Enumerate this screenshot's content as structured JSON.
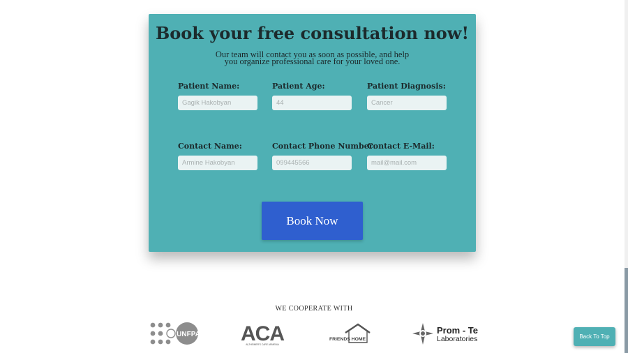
{
  "form": {
    "title": "Book your free consultation now!",
    "subtitle": "Our team will contact you as soon as possible, and help you organize professional care for your loved one.",
    "fields": [
      {
        "label": "Patient Name:",
        "placeholder": "Gagik Hakobyan"
      },
      {
        "label": "Patient Age:",
        "placeholder": "44"
      },
      {
        "label": "Patient Diagnosis:",
        "placeholder": "Cancer"
      },
      {
        "label": "Contact Name:",
        "placeholder": "Armine Hakobyan"
      },
      {
        "label": "Contact Phone Number:",
        "placeholder": "099445566"
      },
      {
        "label": "Contact E-Mail:",
        "placeholder": "mail@mail.com"
      }
    ],
    "submit_label": "Book Now"
  },
  "partners": {
    "title": "WE COOPERATE WITH",
    "logos": [
      {
        "name": "UNFPA",
        "text": "UNFPA"
      },
      {
        "name": "ACA",
        "text": "ACA",
        "tagline": "ALZHEIMER'S CARE ARMENIA"
      },
      {
        "name": "Friends Home",
        "text": "FRIENDS HOME"
      },
      {
        "name": "Prom - Test Laboratories",
        "line1": "Prom - Test",
        "line2": "Laboratories"
      }
    ]
  },
  "back_to_top_label": "Back To Top",
  "colors": {
    "card": "#4fb0b4",
    "button": "#2f5fcf",
    "text": "#1c2a2c"
  }
}
